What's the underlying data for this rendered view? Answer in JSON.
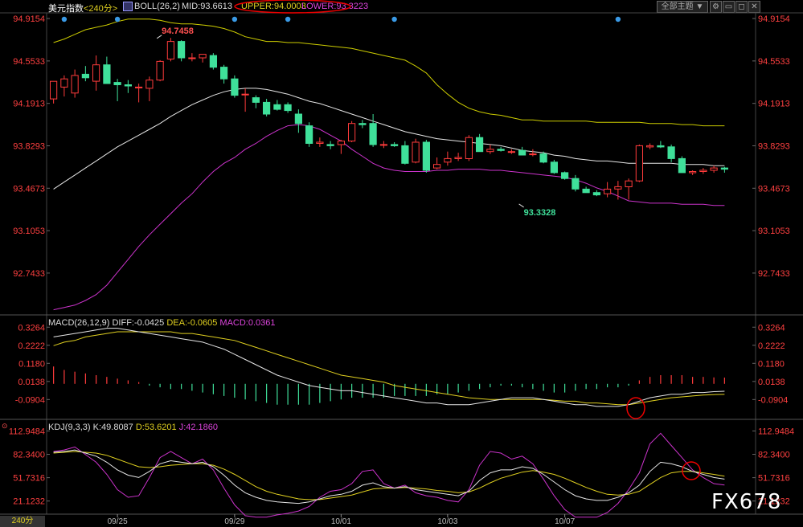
{
  "header": {
    "symbol": "美元指数",
    "period": "<240分>",
    "indicator": "BOLL(26,2)",
    "mid": "MID:93.6613",
    "upper": "UPPER:94.0003",
    "lower": "LOWER:93.3223",
    "theme_btn": "全部主题",
    "theme_arrow": "▼"
  },
  "macd_header": {
    "name": "MACD(26,12,9)",
    "diff": "DIFF:-0.0425",
    "dea": "DEA:-0.0605",
    "macd": "MACD:0.0361"
  },
  "kdj_header": {
    "name": "KDJ(9,3,3)",
    "k": "K:49.8087",
    "d": "D:53.6201",
    "j": "J:42.1860"
  },
  "period_tab": "240分",
  "watermark": "FX678",
  "colors": {
    "up": "#ff3b3b",
    "down": "#3fe09a",
    "mid": "#e6e6e6",
    "upper": "#cccc00",
    "lower": "#cc33cc",
    "dea": "#e0d020",
    "j": "#cc33cc",
    "axis": "#ff4040"
  },
  "chart_data": [
    {
      "type": "candlestick",
      "title": "美元指数 240分 BOLL(26,2)",
      "ylim": [
        92.4,
        94.95
      ],
      "y_ticks": [
        "94.9154",
        "94.5533",
        "94.1913",
        "93.8293",
        "93.4673",
        "93.1053",
        "92.7433"
      ],
      "x_labels": [
        "09/25",
        "09/29",
        "10/01",
        "10/03",
        "10/07"
      ],
      "x_label_index": [
        6,
        17,
        27,
        37,
        48
      ],
      "annotations": [
        {
          "text": "94.7458",
          "index": 10,
          "value": 94.7458,
          "position": "above"
        },
        {
          "text": "93.3328",
          "index": 44,
          "value": 93.3328,
          "position": "below"
        }
      ],
      "markers_index": [
        1,
        6,
        17,
        22,
        32,
        53
      ],
      "candles": [
        {
          "o": 94.23,
          "h": 94.38,
          "l": 94.19,
          "c": 94.38
        },
        {
          "o": 94.33,
          "h": 94.43,
          "l": 94.25,
          "c": 94.4
        },
        {
          "o": 94.28,
          "h": 94.48,
          "l": 94.24,
          "c": 94.43
        },
        {
          "o": 94.44,
          "h": 94.51,
          "l": 94.38,
          "c": 94.41
        },
        {
          "o": 94.38,
          "h": 94.6,
          "l": 94.3,
          "c": 94.52
        },
        {
          "o": 94.52,
          "h": 94.59,
          "l": 94.36,
          "c": 94.36
        },
        {
          "o": 94.37,
          "h": 94.4,
          "l": 94.21,
          "c": 94.35
        },
        {
          "o": 94.35,
          "h": 94.39,
          "l": 94.28,
          "c": 94.34
        },
        {
          "o": 94.33,
          "h": 94.36,
          "l": 94.2,
          "c": 94.33
        },
        {
          "o": 94.32,
          "h": 94.42,
          "l": 94.21,
          "c": 94.39
        },
        {
          "o": 94.39,
          "h": 94.56,
          "l": 94.38,
          "c": 94.55
        },
        {
          "o": 94.57,
          "h": 94.75,
          "l": 94.55,
          "c": 94.72
        },
        {
          "o": 94.72,
          "h": 94.73,
          "l": 94.55,
          "c": 94.58
        },
        {
          "o": 94.58,
          "h": 94.62,
          "l": 94.55,
          "c": 94.58
        },
        {
          "o": 94.58,
          "h": 94.61,
          "l": 94.54,
          "c": 94.61
        },
        {
          "o": 94.6,
          "h": 94.62,
          "l": 94.48,
          "c": 94.5
        },
        {
          "o": 94.5,
          "h": 94.52,
          "l": 94.36,
          "c": 94.4
        },
        {
          "o": 94.4,
          "h": 94.43,
          "l": 94.24,
          "c": 94.26
        },
        {
          "o": 94.27,
          "h": 94.32,
          "l": 94.12,
          "c": 94.27
        },
        {
          "o": 94.24,
          "h": 94.26,
          "l": 94.15,
          "c": 94.2
        },
        {
          "o": 94.2,
          "h": 94.23,
          "l": 94.08,
          "c": 94.1
        },
        {
          "o": 94.18,
          "h": 94.22,
          "l": 94.13,
          "c": 94.14
        },
        {
          "o": 94.18,
          "h": 94.2,
          "l": 94.11,
          "c": 94.13
        },
        {
          "o": 94.1,
          "h": 94.14,
          "l": 93.94,
          "c": 94.02
        },
        {
          "o": 94.0,
          "h": 94.03,
          "l": 93.82,
          "c": 93.85
        },
        {
          "o": 93.85,
          "h": 93.9,
          "l": 93.82,
          "c": 93.86
        },
        {
          "o": 93.84,
          "h": 93.87,
          "l": 93.8,
          "c": 93.83
        },
        {
          "o": 93.84,
          "h": 93.88,
          "l": 93.76,
          "c": 93.87
        },
        {
          "o": 93.87,
          "h": 94.04,
          "l": 93.86,
          "c": 94.02
        },
        {
          "o": 94.02,
          "h": 94.05,
          "l": 93.98,
          "c": 94.01
        },
        {
          "o": 94.02,
          "h": 94.1,
          "l": 93.82,
          "c": 93.84
        },
        {
          "o": 93.84,
          "h": 93.87,
          "l": 93.81,
          "c": 93.84
        },
        {
          "o": 93.84,
          "h": 93.86,
          "l": 93.82,
          "c": 93.83
        },
        {
          "o": 93.83,
          "h": 93.87,
          "l": 93.67,
          "c": 93.68
        },
        {
          "o": 93.69,
          "h": 93.89,
          "l": 93.68,
          "c": 93.86
        },
        {
          "o": 93.86,
          "h": 93.88,
          "l": 93.6,
          "c": 93.62
        },
        {
          "o": 93.64,
          "h": 93.73,
          "l": 93.63,
          "c": 93.67
        },
        {
          "o": 93.69,
          "h": 93.78,
          "l": 93.66,
          "c": 93.72
        },
        {
          "o": 93.72,
          "h": 93.77,
          "l": 93.7,
          "c": 93.73
        },
        {
          "o": 93.72,
          "h": 93.92,
          "l": 93.7,
          "c": 93.9
        },
        {
          "o": 93.9,
          "h": 93.93,
          "l": 93.78,
          "c": 93.78
        },
        {
          "o": 93.78,
          "h": 93.84,
          "l": 93.76,
          "c": 93.8
        },
        {
          "o": 93.8,
          "h": 93.82,
          "l": 93.78,
          "c": 93.79
        },
        {
          "o": 93.78,
          "h": 93.8,
          "l": 93.76,
          "c": 93.78
        },
        {
          "o": 93.79,
          "h": 93.82,
          "l": 93.75,
          "c": 93.75
        },
        {
          "o": 93.76,
          "h": 93.8,
          "l": 93.74,
          "c": 93.76
        },
        {
          "o": 93.76,
          "h": 93.78,
          "l": 93.68,
          "c": 93.69
        },
        {
          "o": 93.69,
          "h": 93.71,
          "l": 93.59,
          "c": 93.6
        },
        {
          "o": 93.6,
          "h": 93.61,
          "l": 93.54,
          "c": 93.55
        },
        {
          "o": 93.55,
          "h": 93.58,
          "l": 93.44,
          "c": 93.46
        },
        {
          "o": 93.46,
          "h": 93.48,
          "l": 93.43,
          "c": 93.43
        },
        {
          "o": 93.43,
          "h": 93.45,
          "l": 93.4,
          "c": 93.41
        },
        {
          "o": 93.42,
          "h": 93.52,
          "l": 93.39,
          "c": 93.46
        },
        {
          "o": 93.46,
          "h": 93.53,
          "l": 93.37,
          "c": 93.48
        },
        {
          "o": 93.48,
          "h": 93.55,
          "l": 93.37,
          "c": 93.53
        },
        {
          "o": 93.53,
          "h": 93.84,
          "l": 93.52,
          "c": 93.83
        },
        {
          "o": 93.82,
          "h": 93.85,
          "l": 93.8,
          "c": 93.83
        },
        {
          "o": 93.83,
          "h": 93.87,
          "l": 93.81,
          "c": 93.82
        },
        {
          "o": 93.82,
          "h": 93.84,
          "l": 93.69,
          "c": 93.72
        },
        {
          "o": 93.72,
          "h": 93.74,
          "l": 93.6,
          "c": 93.6
        },
        {
          "o": 93.6,
          "h": 93.62,
          "l": 93.58,
          "c": 93.61
        },
        {
          "o": 93.61,
          "h": 93.64,
          "l": 93.59,
          "c": 93.62
        },
        {
          "o": 93.62,
          "h": 93.66,
          "l": 93.6,
          "c": 93.64
        },
        {
          "o": 93.64,
          "h": 93.65,
          "l": 93.6,
          "c": 93.63
        }
      ],
      "mid": [
        93.46,
        93.52,
        93.58,
        93.64,
        93.7,
        93.76,
        93.82,
        93.87,
        93.92,
        93.97,
        94.02,
        94.08,
        94.13,
        94.18,
        94.22,
        94.26,
        94.29,
        94.31,
        94.32,
        94.32,
        94.31,
        94.29,
        94.27,
        94.24,
        94.21,
        94.19,
        94.16,
        94.13,
        94.1,
        94.07,
        94.04,
        94.01,
        93.98,
        93.95,
        93.93,
        93.91,
        93.89,
        93.88,
        93.87,
        93.86,
        93.85,
        93.84,
        93.83,
        93.81,
        93.79,
        93.78,
        93.77,
        93.75,
        93.74,
        93.72,
        93.71,
        93.7,
        93.7,
        93.69,
        93.68,
        93.68,
        93.68,
        93.68,
        93.68,
        93.67,
        93.67,
        93.67,
        93.66,
        93.66
      ],
      "upper": [
        94.71,
        94.74,
        94.78,
        94.82,
        94.84,
        94.86,
        94.89,
        94.91,
        94.91,
        94.91,
        94.9,
        94.88,
        94.87,
        94.87,
        94.86,
        94.85,
        94.83,
        94.8,
        94.76,
        94.74,
        94.72,
        94.72,
        94.71,
        94.71,
        94.7,
        94.69,
        94.68,
        94.67,
        94.66,
        94.64,
        94.62,
        94.6,
        94.58,
        94.56,
        94.51,
        94.45,
        94.35,
        94.27,
        94.2,
        94.15,
        94.12,
        94.1,
        94.09,
        94.07,
        94.05,
        94.05,
        94.04,
        94.04,
        94.04,
        94.04,
        94.04,
        94.03,
        94.03,
        94.03,
        94.03,
        94.03,
        94.02,
        94.02,
        94.02,
        94.01,
        94.01,
        94.0,
        94.0,
        94.0
      ],
      "lower": [
        92.43,
        92.45,
        92.47,
        92.51,
        92.56,
        92.64,
        92.75,
        92.86,
        92.97,
        93.07,
        93.16,
        93.25,
        93.34,
        93.42,
        93.52,
        93.61,
        93.68,
        93.73,
        93.8,
        93.85,
        93.91,
        93.96,
        94.0,
        94.01,
        94.0,
        93.97,
        93.92,
        93.87,
        93.8,
        93.74,
        93.68,
        93.64,
        93.62,
        93.61,
        93.61,
        93.61,
        93.62,
        93.62,
        93.63,
        93.63,
        93.63,
        93.62,
        93.62,
        93.61,
        93.6,
        93.59,
        93.58,
        93.57,
        93.56,
        93.54,
        93.51,
        93.47,
        93.44,
        93.4,
        93.36,
        93.35,
        93.34,
        93.34,
        93.34,
        93.33,
        93.33,
        93.33,
        93.32,
        93.32
      ]
    },
    {
      "type": "macd",
      "title": "MACD(26,12,9)",
      "ylim": [
        -0.2,
        0.36
      ],
      "y_ticks": [
        "0.3264",
        "0.2222",
        "0.1180",
        "0.0138",
        "-0.0904"
      ],
      "diff": [
        0.27,
        0.28,
        0.29,
        0.3,
        0.31,
        0.32,
        0.32,
        0.31,
        0.3,
        0.29,
        0.28,
        0.27,
        0.26,
        0.25,
        0.24,
        0.22,
        0.2,
        0.17,
        0.14,
        0.11,
        0.08,
        0.05,
        0.03,
        0.01,
        -0.01,
        -0.02,
        -0.03,
        -0.04,
        -0.04,
        -0.05,
        -0.06,
        -0.07,
        -0.08,
        -0.09,
        -0.1,
        -0.11,
        -0.11,
        -0.12,
        -0.12,
        -0.12,
        -0.11,
        -0.1,
        -0.09,
        -0.08,
        -0.08,
        -0.08,
        -0.09,
        -0.1,
        -0.11,
        -0.12,
        -0.12,
        -0.13,
        -0.13,
        -0.13,
        -0.12,
        -0.1,
        -0.08,
        -0.07,
        -0.06,
        -0.06,
        -0.05,
        -0.05,
        -0.045,
        -0.0425
      ],
      "dea": [
        0.22,
        0.24,
        0.25,
        0.27,
        0.28,
        0.29,
        0.3,
        0.3,
        0.3,
        0.3,
        0.3,
        0.3,
        0.29,
        0.29,
        0.28,
        0.27,
        0.26,
        0.25,
        0.23,
        0.21,
        0.19,
        0.17,
        0.15,
        0.13,
        0.11,
        0.09,
        0.07,
        0.05,
        0.04,
        0.03,
        0.02,
        0.01,
        -0.01,
        -0.02,
        -0.03,
        -0.04,
        -0.05,
        -0.06,
        -0.07,
        -0.08,
        -0.085,
        -0.09,
        -0.09,
        -0.09,
        -0.09,
        -0.09,
        -0.09,
        -0.095,
        -0.1,
        -0.1,
        -0.11,
        -0.11,
        -0.115,
        -0.12,
        -0.12,
        -0.11,
        -0.1,
        -0.09,
        -0.08,
        -0.075,
        -0.07,
        -0.065,
        -0.062,
        -0.0605
      ],
      "macd": [
        0.1,
        0.08,
        0.07,
        0.06,
        0.05,
        0.04,
        0.03,
        0.02,
        0.01,
        -0.01,
        -0.02,
        -0.03,
        -0.03,
        -0.04,
        -0.05,
        -0.06,
        -0.07,
        -0.08,
        -0.09,
        -0.1,
        -0.11,
        -0.12,
        -0.12,
        -0.12,
        -0.12,
        -0.11,
        -0.1,
        -0.09,
        -0.08,
        -0.08,
        -0.08,
        -0.08,
        -0.07,
        -0.07,
        -0.07,
        -0.07,
        -0.06,
        -0.06,
        -0.05,
        -0.04,
        -0.03,
        -0.02,
        -0.01,
        -0.01,
        -0.02,
        -0.03,
        -0.04,
        -0.05,
        -0.05,
        -0.04,
        -0.03,
        -0.03,
        -0.02,
        -0.02,
        -0.01,
        0.02,
        0.04,
        0.05,
        0.05,
        0.05,
        0.04,
        0.04,
        0.037,
        0.0361
      ]
    },
    {
      "type": "kdj",
      "title": "KDJ(9,3,3)",
      "ylim": [
        5,
        125
      ],
      "y_ticks": [
        "112.9484",
        "82.3400",
        "51.7316",
        "21.1232"
      ],
      "k": [
        85,
        86,
        88,
        84,
        80,
        72,
        62,
        55,
        52,
        60,
        70,
        74,
        72,
        70,
        72,
        66,
        55,
        42,
        32,
        26,
        22,
        20,
        19,
        18,
        20,
        24,
        28,
        30,
        34,
        42,
        45,
        40,
        38,
        40,
        36,
        34,
        32,
        30,
        28,
        34,
        48,
        58,
        62,
        62,
        66,
        64,
        56,
        46,
        36,
        28,
        24,
        22,
        22,
        26,
        32,
        42,
        60,
        72,
        70,
        66,
        60,
        56,
        52,
        49.8
      ],
      "d": [
        84,
        85,
        86,
        85,
        84,
        81,
        76,
        71,
        66,
        65,
        66,
        68,
        69,
        70,
        70,
        68,
        63,
        56,
        48,
        40,
        34,
        30,
        27,
        24,
        23,
        23,
        25,
        27,
        29,
        33,
        37,
        38,
        38,
        39,
        38,
        37,
        35,
        34,
        32,
        33,
        38,
        45,
        51,
        55,
        59,
        61,
        59,
        56,
        51,
        45,
        39,
        34,
        30,
        29,
        30,
        34,
        43,
        52,
        58,
        60,
        60,
        58,
        56,
        53.6
      ],
      "j": [
        86,
        88,
        92,
        82,
        72,
        56,
        36,
        26,
        28,
        52,
        78,
        86,
        78,
        70,
        76,
        62,
        38,
        16,
        2,
        0,
        0,
        3,
        5,
        8,
        14,
        26,
        34,
        36,
        44,
        60,
        62,
        44,
        38,
        42,
        32,
        28,
        26,
        22,
        20,
        36,
        68,
        86,
        84,
        76,
        80,
        70,
        50,
        28,
        10,
        0,
        0,
        0,
        6,
        18,
        36,
        58,
        96,
        110,
        94,
        78,
        62,
        52,
        44,
        42.2
      ]
    }
  ]
}
